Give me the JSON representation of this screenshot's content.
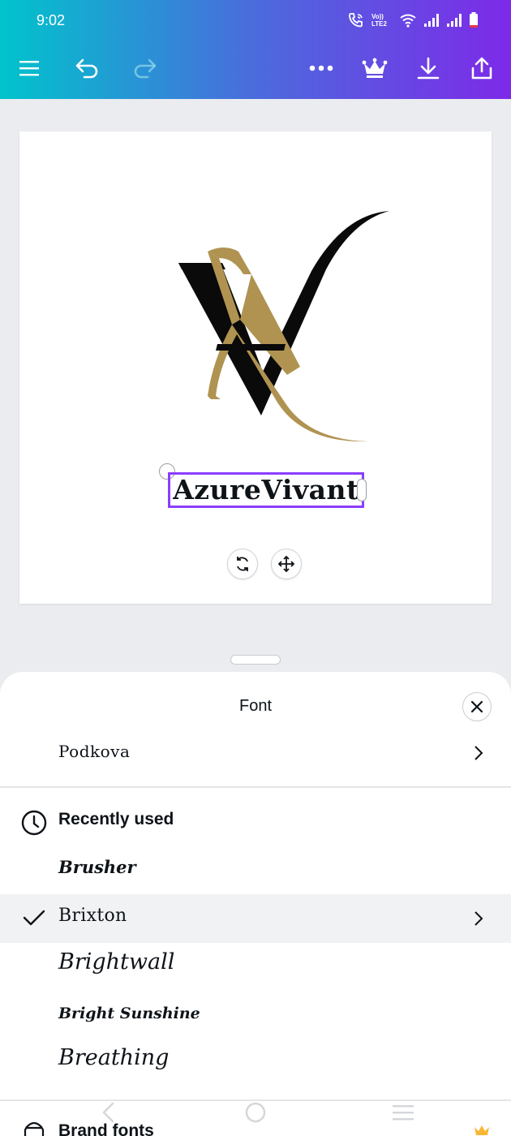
{
  "status_bar": {
    "time": "9:02",
    "icons": [
      "call-wifi-icon",
      "volte-icon",
      "wifi-icon",
      "signal-icon",
      "signal-icon",
      "battery-icon"
    ],
    "volte_text": "Vo)) LTE2"
  },
  "toolbar": {
    "icons": [
      "menu-icon",
      "undo-icon",
      "redo-icon",
      "more-icon",
      "crown-icon",
      "download-icon",
      "share-icon"
    ],
    "accent_start": "#00c4cc",
    "accent_end": "#7d2ae8"
  },
  "canvas": {
    "logo_text": "AV",
    "brand_text": "AzureVivant",
    "logo_colors": {
      "gold": "#b09351",
      "black": "#0a0a0a"
    },
    "selection_color": "#8b3dff"
  },
  "font_panel": {
    "title": "Font",
    "current_font": "Podkova",
    "recent_label": "Recently used",
    "fonts": [
      {
        "name": "Brusher",
        "selected": false
      },
      {
        "name": "Brixton",
        "selected": true
      },
      {
        "name": "Brightwall",
        "selected": false
      },
      {
        "name": "Bright Sunshine",
        "selected": false
      },
      {
        "name": "Breathing",
        "selected": false
      }
    ],
    "brand_fonts_label": "Brand fonts"
  },
  "nav_bar": {
    "icons": [
      "back-icon",
      "home-icon",
      "recents-icon"
    ]
  }
}
